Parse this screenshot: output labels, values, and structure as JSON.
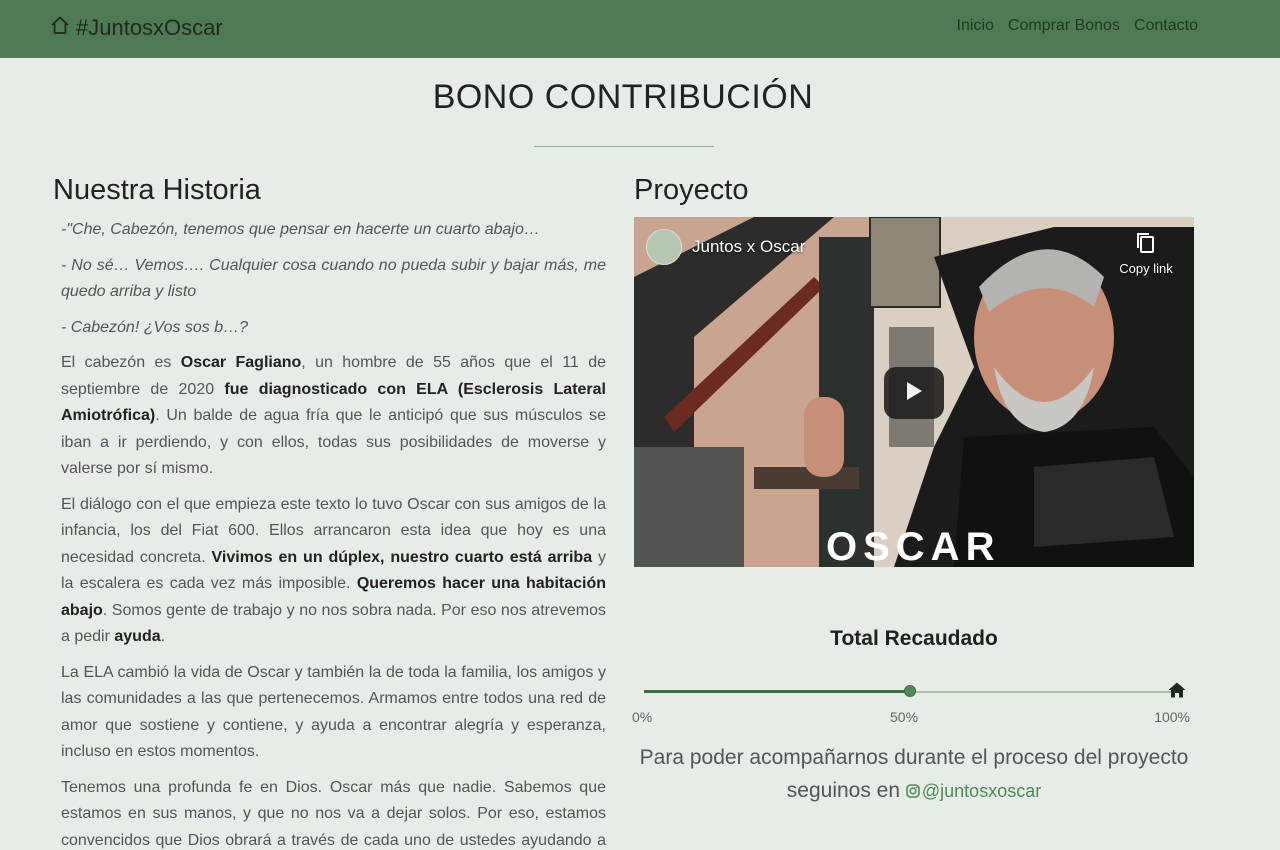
{
  "navbar": {
    "brand": "#JuntosxOscar",
    "brand_icon": "home-outline-icon",
    "links": [
      "Inicio",
      "Comprar Bonos",
      "Contacto"
    ]
  },
  "page": {
    "title": "BONO CONTRIBUCIÓN"
  },
  "story": {
    "heading": "Nuestra Historia",
    "quote1": "-\"Che, Cabezón, tenemos que pensar en hacerte un cuarto abajo…",
    "quote2": "- No sé… Vemos…. Cualquier cosa cuando no pueda subir y bajar más, me quedo arriba y listo",
    "quote3": "- Cabezón! ¿Vos sos b…?",
    "p1_a": "El cabezón es ",
    "p1_b": "Oscar Fagliano",
    "p1_c": ", un hombre de 55 años que el 11 de septiembre de 2020 ",
    "p1_d": "fue diagnosticado con ELA (Esclerosis Lateral Amiotrófica)",
    "p1_e": ". Un balde de agua fría que le anticipó que sus músculos se iban a ir perdiendo, y con ellos, todas sus posibilidades de moverse y valerse por sí mismo.",
    "p2_a": "El diálogo con el que empieza este texto lo tuvo Oscar con sus amigos de la infancia, los del Fiat 600. Ellos arrancaron esta idea que hoy es una necesidad concreta. ",
    "p2_b": "Vivimos en un dúplex, nuestro cuarto está arriba",
    "p2_c": " y la escalera es cada vez más imposible. ",
    "p2_d": "Queremos hacer una habitación abajo",
    "p2_e": ". Somos gente de trabajo y no nos sobra nada. Por eso nos atrevemos a pedir ",
    "p2_f": "ayuda",
    "p2_g": ".",
    "p3": "La ELA cambió la vida de Oscar y también la de toda la familia, los amigos y las comunidades a las que pertenecemos. Armamos entre todos una red de amor que sostiene y contiene, y ayuda a encontrar alegría y esperanza, incluso en estos momentos.",
    "p4": "Tenemos una profunda fe en Dios. Oscar más que nadie. Sabemos que estamos en sus manos, y que no nos va a dejar solos. Por eso, estamos convencidos que Dios obrará a través de cada uno de ustedes ayudando a cumplir esta necesidad."
  },
  "project": {
    "heading": "Proyecto",
    "video": {
      "channel": "Juntos x Oscar",
      "copy_link": "Copy link",
      "watermark": "OSCAR",
      "play_icon": "play-icon",
      "copy_icon": "copy-icon"
    },
    "raised_title": "Total Recaudado",
    "progress": {
      "fraction": 0.5,
      "labels": [
        "0%",
        "50%",
        "100%"
      ],
      "end_icon": "home-icon"
    },
    "follow_text": "Para poder acompañarnos durante el proceso del proyecto seguinos en",
    "instagram_handle": "@juntosxoscar",
    "instagram_icon": "instagram-icon"
  },
  "colors": {
    "navbar": "#4f7a53",
    "background": "#e6ece6",
    "accent": "#4f8a5b"
  }
}
